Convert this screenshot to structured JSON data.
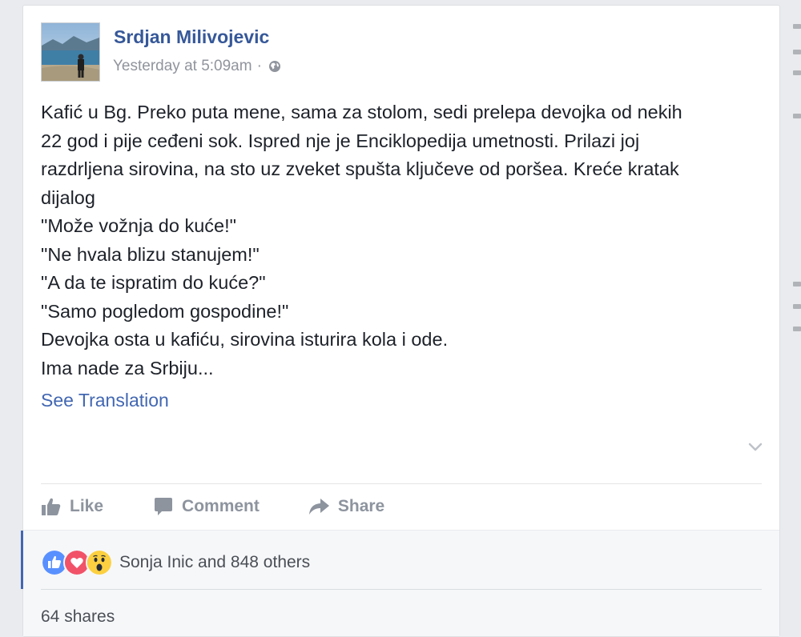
{
  "post": {
    "author": "Srdjan Milivojevic",
    "timestamp": "Yesterday at 5:09am",
    "separator": "·",
    "privacy_icon": "globe-icon",
    "body_lines": [
      "Kafić u Bg. Preko puta mene, sama za stolom, sedi prelepa devojka od nekih",
      "22 god i pije ceđeni sok. Ispred nje je Enciklopedija umetnosti. Prilazi joj",
      "razdrljena sirovina, na sto uz zveket spušta ključeve od poršea. Kreće kratak",
      "dijalog",
      "\"Može vožnja do kuće!\"",
      "\"Ne hvala blizu stanujem!\"",
      "\"A da te ispratim do kuće?\"",
      "\"Samo pogledom gospodine!\"",
      "Devojka osta u kafiću, sirovina isturira kola i ode.",
      "Ima nade za Srbiju..."
    ],
    "see_translation": "See Translation"
  },
  "actions": {
    "like": "Like",
    "comment": "Comment",
    "share": "Share"
  },
  "footer": {
    "reactions": [
      "like-reaction-icon",
      "love-reaction-icon",
      "wow-reaction-icon"
    ],
    "reaction_summary": "Sonja Inic and 848 others",
    "shares": "64 shares"
  },
  "colors": {
    "link": "#365899",
    "accent": "#4267b2",
    "muted": "#90949c",
    "text": "#1d2129",
    "like": "#5890ff",
    "love": "#f25268",
    "wow": "#fcd040"
  }
}
